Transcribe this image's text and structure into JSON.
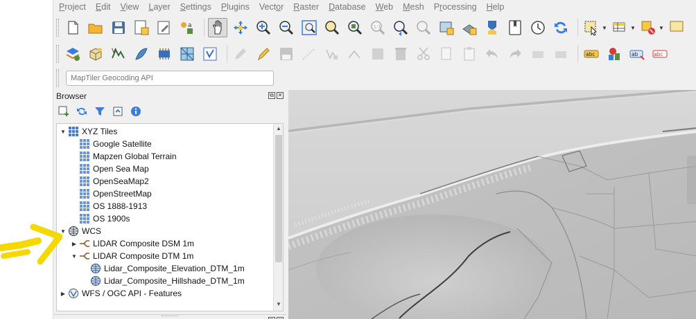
{
  "menubar": {
    "items": [
      "Project",
      "Edit",
      "View",
      "Layer",
      "Settings",
      "Plugins",
      "Vector",
      "Raster",
      "Database",
      "Web",
      "Mesh",
      "Processing",
      "Help"
    ],
    "underlined": [
      "P",
      "E",
      "V",
      "L",
      "S",
      "P",
      "o",
      "R",
      "D",
      "W",
      "M",
      "r",
      "H"
    ]
  },
  "toolbar_icons_row1": [
    "new-project-icon",
    "open-project-icon",
    "save-project-icon",
    "new-print-layout-icon",
    "layout-manager-icon",
    "style-manager-icon",
    "pan-map-icon",
    "pan-to-selection-icon",
    "zoom-in-icon",
    "zoom-out-icon",
    "zoom-full-icon",
    "zoom-to-selection-icon",
    "zoom-to-layer-icon",
    "zoom-native-icon",
    "zoom-last-icon",
    "zoom-next-icon",
    "new-map-view-icon",
    "new-3d-map-icon",
    "temporal-controller-icon",
    "bookmarks-icon",
    "show-bookmarks-icon",
    "refresh-icon",
    "select-features-icon",
    "attribute-table-icon",
    "deselect-icon",
    "measure-icon"
  ],
  "toolbar_icons_row2": [
    "data-source-manager-icon",
    "new-geopackage-layer-icon",
    "new-shapefile-layer-icon",
    "new-spatialite-layer-icon",
    "new-virtual-layer-icon",
    "new-mesh-layer-icon",
    "new-temp-scratch-layer-icon",
    "current-edits-icon",
    "toggle-editing-icon",
    "save-edits-icon",
    "digitize-icon",
    "vertex-tool-icon",
    "modify-attributes-icon",
    "delete-selected-icon",
    "cut-features-icon",
    "copy-features-icon",
    "paste-features-icon",
    "undo-icon",
    "redo-icon",
    "label-toolbar-icon",
    "diagram-icon",
    "layer-labeling-icon",
    "highlight-pinned-labels-icon"
  ],
  "locator": {
    "placeholder": "MapTiler Geocoding API"
  },
  "browser": {
    "title": "Browser",
    "tools": [
      "add-selected-layers-icon",
      "refresh-icon",
      "filter-icon",
      "collapse-all-icon",
      "info-icon"
    ],
    "tree": [
      {
        "label": "XYZ Tiles",
        "level": 0,
        "expanded": true,
        "icon": "xyz-tiles-icon"
      },
      {
        "label": "Google Satellite",
        "level": 1,
        "icon": "xyz-grid-icon"
      },
      {
        "label": "Mapzen Global Terrain",
        "level": 1,
        "icon": "xyz-grid-icon"
      },
      {
        "label": "Open Sea Map",
        "level": 1,
        "icon": "xyz-grid-icon"
      },
      {
        "label": "OpenSeaMap2",
        "level": 1,
        "icon": "xyz-grid-icon"
      },
      {
        "label": "OpenStreetMap",
        "level": 1,
        "icon": "xyz-grid-icon"
      },
      {
        "label": "OS 1888-1913",
        "level": 1,
        "icon": "xyz-grid-icon"
      },
      {
        "label": "OS 1900s",
        "level": 1,
        "icon": "xyz-grid-icon"
      },
      {
        "label": "WCS",
        "level": 0,
        "expanded": true,
        "icon": "wcs-globe-icon"
      },
      {
        "label": "LIDAR Composite DSM 1m",
        "level": 1,
        "expanded": false,
        "icon": "wcs-connection-icon"
      },
      {
        "label": "LIDAR Composite DTM 1m",
        "level": 1,
        "expanded": true,
        "icon": "wcs-connection-icon"
      },
      {
        "label": "Lidar_Composite_Elevation_DTM_1m",
        "level": 2,
        "icon": "coverage-globe-icon"
      },
      {
        "label": "Lidar_Composite_Hillshade_DTM_1m",
        "level": 2,
        "icon": "coverage-globe-icon"
      },
      {
        "label": "WFS / OGC API - Features",
        "level": 0,
        "expanded": false,
        "icon": "wfs-icon"
      }
    ]
  },
  "colors": {
    "accent_yellow": "#f5d800",
    "menu_text": "#777777",
    "panel_bg": "#f0f0f0",
    "grid_icon": "#4a7bc8",
    "wcs_icon": "#8a5a2b"
  }
}
